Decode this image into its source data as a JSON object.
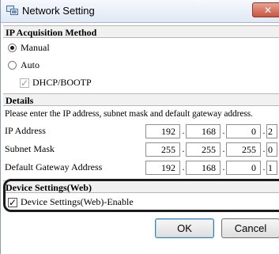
{
  "window": {
    "title": "Network Setting"
  },
  "ip_acquisition": {
    "header": "IP Acquisition Method",
    "options": [
      {
        "label": "Manual",
        "selected": true
      },
      {
        "label": "Auto",
        "selected": false
      }
    ],
    "dhcp": {
      "label": "DHCP/BOOTP",
      "checked": true,
      "enabled": false
    }
  },
  "details": {
    "header": "Details",
    "description": "Please enter the IP address, subnet mask and default gateway address.",
    "rows": [
      {
        "label": "IP Address",
        "octets": [
          "192",
          "168",
          "0",
          "2"
        ]
      },
      {
        "label": "Subnet Mask",
        "octets": [
          "255",
          "255",
          "255",
          "0"
        ]
      },
      {
        "label": "Default Gateway Address",
        "octets": [
          "192",
          "168",
          "0",
          "1"
        ]
      }
    ]
  },
  "device_settings": {
    "header": "Device Settings(Web)",
    "enable_label": "Device Settings(Web)-Enable",
    "enabled": true
  },
  "buttons": {
    "ok": "OK",
    "cancel": "Cancel"
  },
  "colors": {
    "close_button": "#c75641",
    "highlight_border": "#1b1b1b",
    "section_bg": "#f1f1f1"
  }
}
